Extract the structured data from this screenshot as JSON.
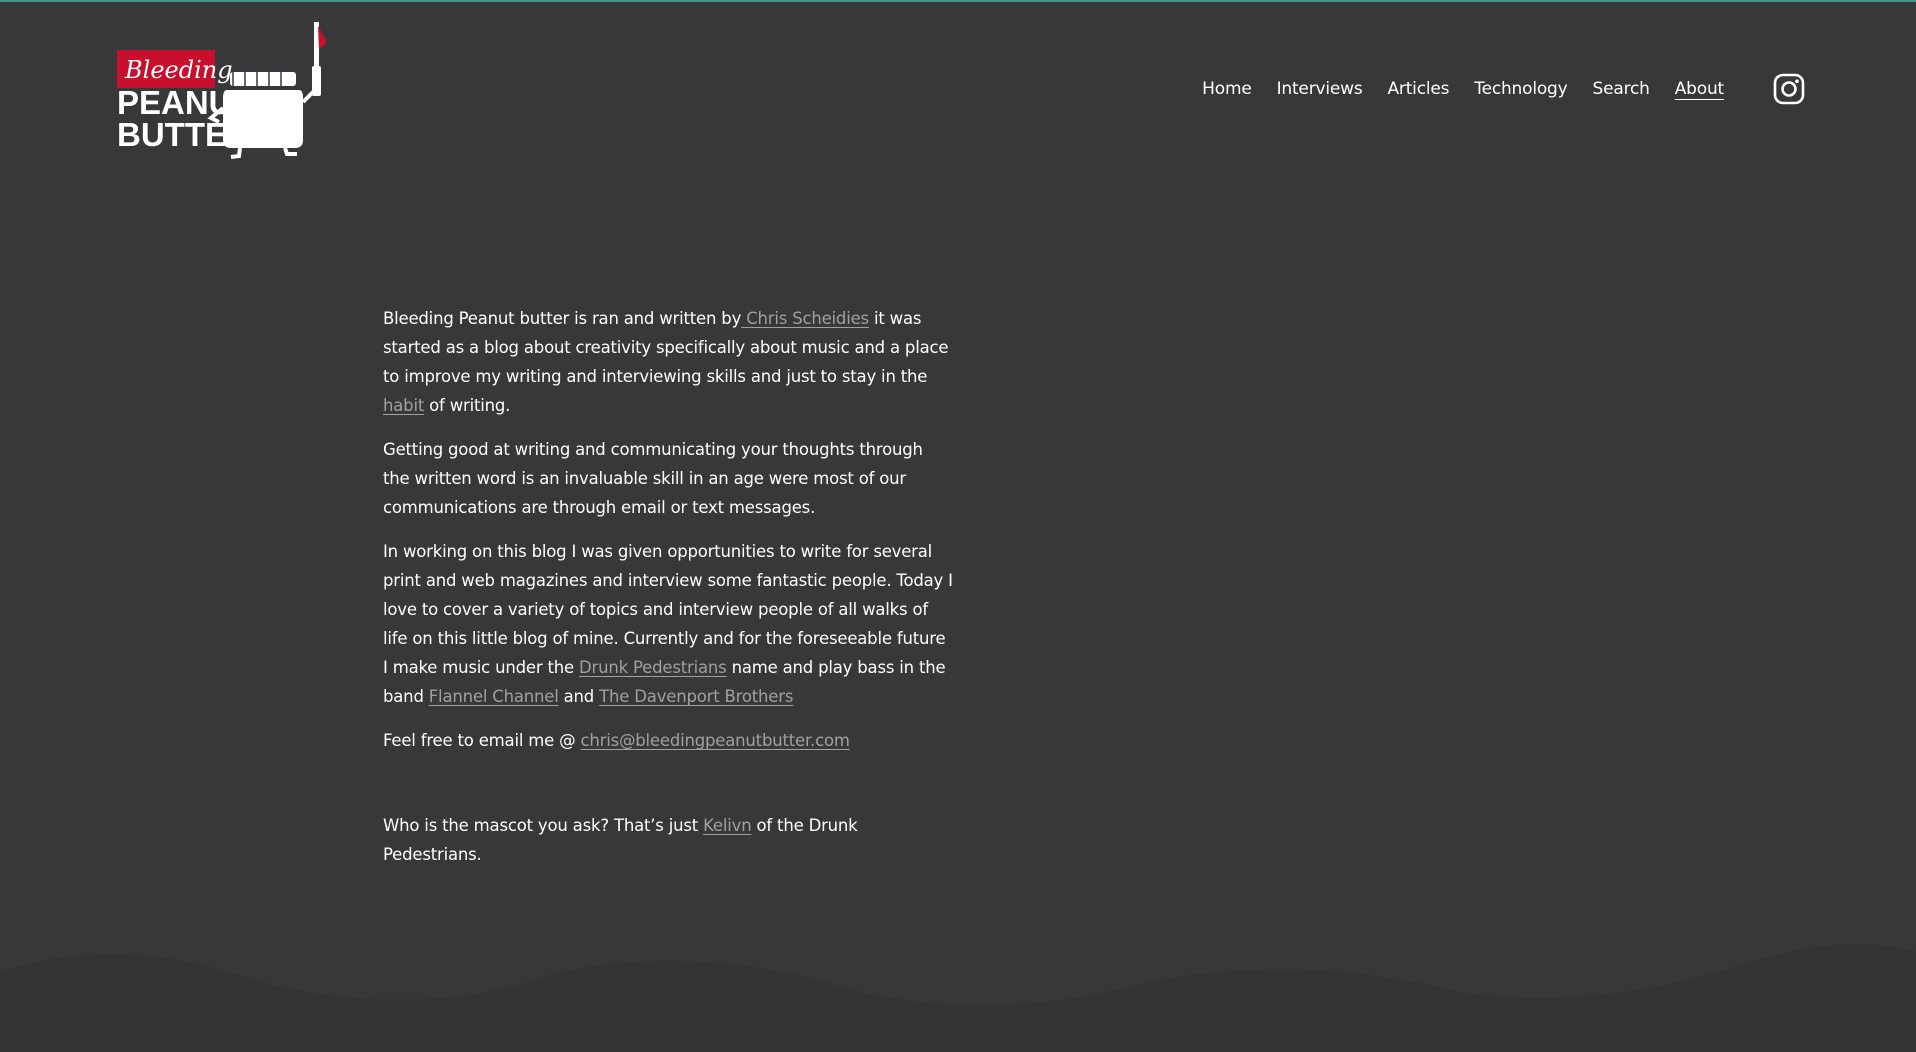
{
  "logo": {
    "script_text": "Bleeding",
    "line1": "PEANUT",
    "line2": "BUTTER"
  },
  "nav": {
    "items": [
      "Home",
      "Interviews",
      "Articles",
      "Technology",
      "Search",
      "About"
    ],
    "active": "About"
  },
  "social": {
    "icon": "instagram-icon"
  },
  "about": {
    "p1": {
      "t1": "Bleeding Peanut butter is ran and written by",
      "link1": " Chris Scheidies",
      "t2": " it was started as a blog about creativity specifically about music and a place to improve my writing and interviewing skills and just to stay in the ",
      "link2": "habit",
      "t3": " of writing."
    },
    "p2": "Getting good at writing and communicating your thoughts through the written word is an invaluable skill in an age were most of our communications are through email or text messages.",
    "p3": {
      "t1": "In working on this blog I was given opportunities to write for several print and web magazines and interview some fantastic people. Today I love to cover a variety of topics and interview people of all walks of life on this little blog of mine. Currently and for the foreseeable future I make music under the ",
      "link1": "Drunk Pedestrians",
      "t2": " name and play bass in the band ",
      "link2": "Flannel Channel",
      "t3": " and ",
      "link3": "The Davenport Brothers"
    },
    "p4": {
      "t1": "Feel free to email me @ ",
      "email": "chris@bleedingpeanutbutter.com"
    },
    "p5": {
      "t1": "Who is the mascot you ask? That’s just ",
      "link1": "Kelivn",
      "t2": " of the Drunk Pedestrians."
    }
  },
  "colors": {
    "background": "#38383b",
    "link": "#a0a0a3",
    "logo_red": "#c8102e",
    "top_border": "#4a8f92"
  }
}
